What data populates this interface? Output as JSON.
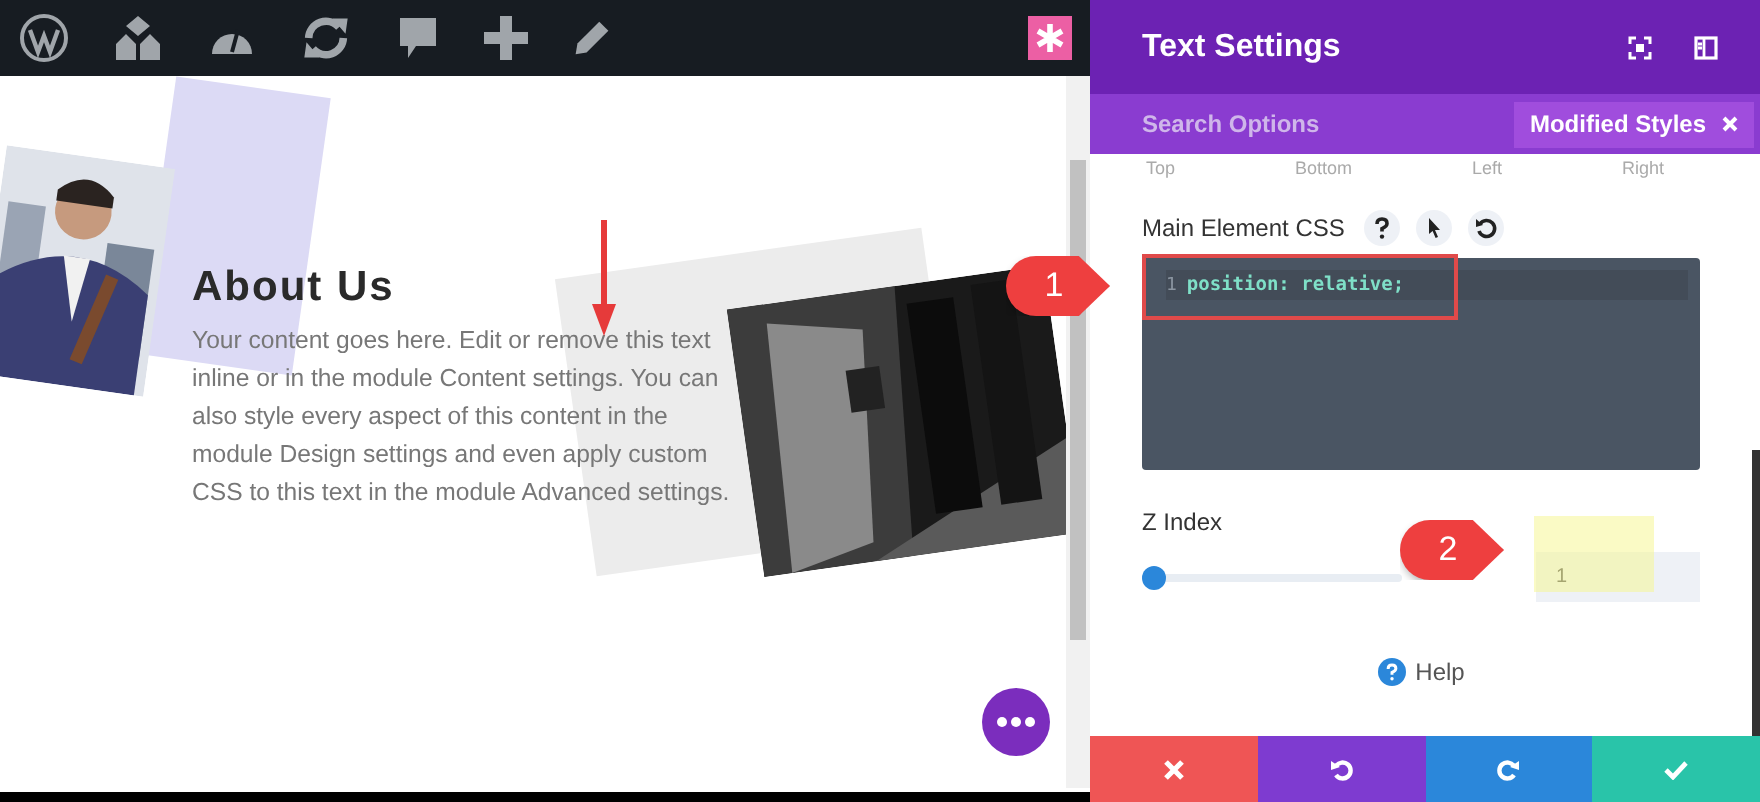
{
  "page": {
    "heading": "About Us",
    "body": "Your content goes here. Edit or remove this text inline or in the module Content settings. You can also style every aspect of this content in the module Design settings and even apply custom CSS to this text in the module Advanced settings."
  },
  "settings_panel": {
    "title": "Text Settings",
    "search": {
      "placeholder": "Search Options"
    },
    "filter_button": "Modified Styles",
    "spacing_labels": [
      "Top",
      "Bottom",
      "Left",
      "Right"
    ],
    "css_field": {
      "label": "Main Element CSS",
      "lines": [
        {
          "number": "1",
          "code": "position: relative;"
        }
      ]
    },
    "z_index": {
      "label": "Z Index",
      "level": 0,
      "value": "1"
    },
    "help": "Help",
    "footer_buttons": [
      {
        "kind": "cancel"
      },
      {
        "kind": "undo"
      },
      {
        "kind": "redo"
      },
      {
        "kind": "save"
      }
    ]
  },
  "annotations": [
    {
      "number": "1"
    },
    {
      "number": "2"
    }
  ]
}
